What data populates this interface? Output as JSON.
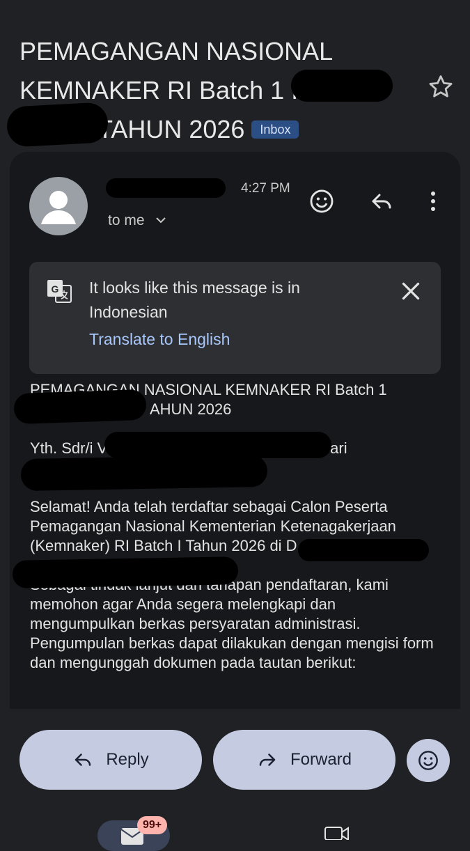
{
  "email": {
    "subject_line1": "PEMAGANGAN NASIONAL",
    "subject_line2": "KEMNAKER RI Batch 1 I",
    "subject_line3": "TAHUN 2026",
    "label_chip": "Inbox",
    "time": "4:27 PM",
    "recipient": "to me"
  },
  "translate_banner": {
    "message": "It looks like this message is in Indonesian",
    "action": "Translate to English"
  },
  "body": {
    "p1_line1": "PEMAGANGAN NASIONAL KEMNAKER RI Batch 1",
    "p1_line2": "AHUN 2026",
    "p2_line1_a": "Yth. Sdr/i V",
    "p2_line1_b": "Dari",
    "p3": "Selamat! Anda telah terdaftar sebagai Calon Peserta Pemagangan Nasional Kementerian Ketenagakerjaan (Kemnaker) RI Batch I Tahun 2026 di D",
    "p4": "Sebagai tindak lanjut dari tahapan pendaftaran, kami memohon agar Anda segera melengkapi dan mengumpulkan berkas persyaratan administrasi. Pengumpulan berkas dapat dilakukan dengan mengisi form dan mengunggah dokumen pada tautan berikut:"
  },
  "actions": {
    "reply": "Reply",
    "forward": "Forward"
  },
  "nav": {
    "mail_badge": "99+"
  },
  "icons": {
    "star": "star-outline-icon",
    "emoji": "emoji-icon",
    "reply": "reply-icon",
    "more": "more-vert-icon",
    "translate": "google-translate-icon",
    "close": "close-icon",
    "forward": "forward-icon",
    "mail": "mail-icon",
    "video": "video-icon"
  },
  "colors": {
    "background": "#202124",
    "card": "#16181b",
    "link": "#a8c7fa",
    "pill": "#c5cbe0",
    "badge": "#ffb3ad"
  }
}
